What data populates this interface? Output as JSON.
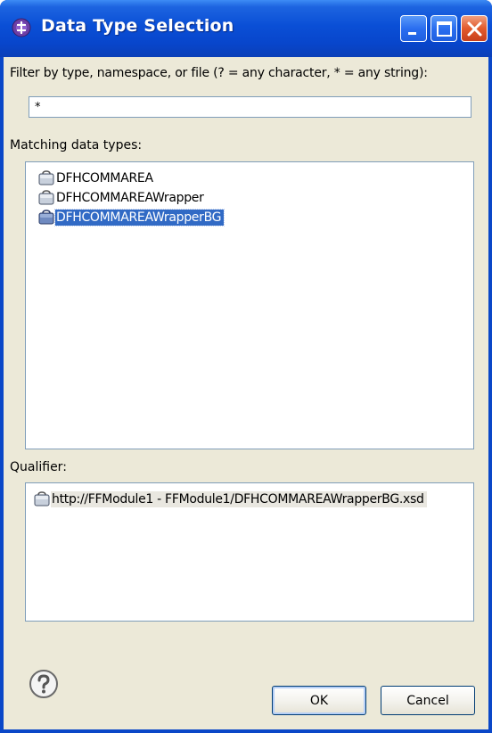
{
  "window": {
    "title": "Data Type Selection"
  },
  "filter": {
    "label": "Filter by type, namespace, or file (? = any character, * = any string):",
    "value": "*"
  },
  "matching": {
    "label": "Matching data types:",
    "items": [
      {
        "label": "DFHCOMMAREA",
        "icon": "business-object-icon",
        "selected": false
      },
      {
        "label": "DFHCOMMAREAWrapper",
        "icon": "business-object-icon",
        "selected": false
      },
      {
        "label": "DFHCOMMAREAWrapperBG",
        "icon": "business-object-icon",
        "selected": true
      }
    ]
  },
  "qualifier": {
    "label": "Qualifier:",
    "items": [
      {
        "label": "http://FFModule1 - FFModule1/DFHCOMMAREAWrapperBG.xsd",
        "icon": "business-object-icon"
      }
    ]
  },
  "buttons": {
    "ok": "OK",
    "cancel": "Cancel",
    "help": "help-icon"
  },
  "colors": {
    "titlebar": "#0a4fd6",
    "selection": "#316ac5",
    "dialog_bg": "#ece9d8"
  }
}
